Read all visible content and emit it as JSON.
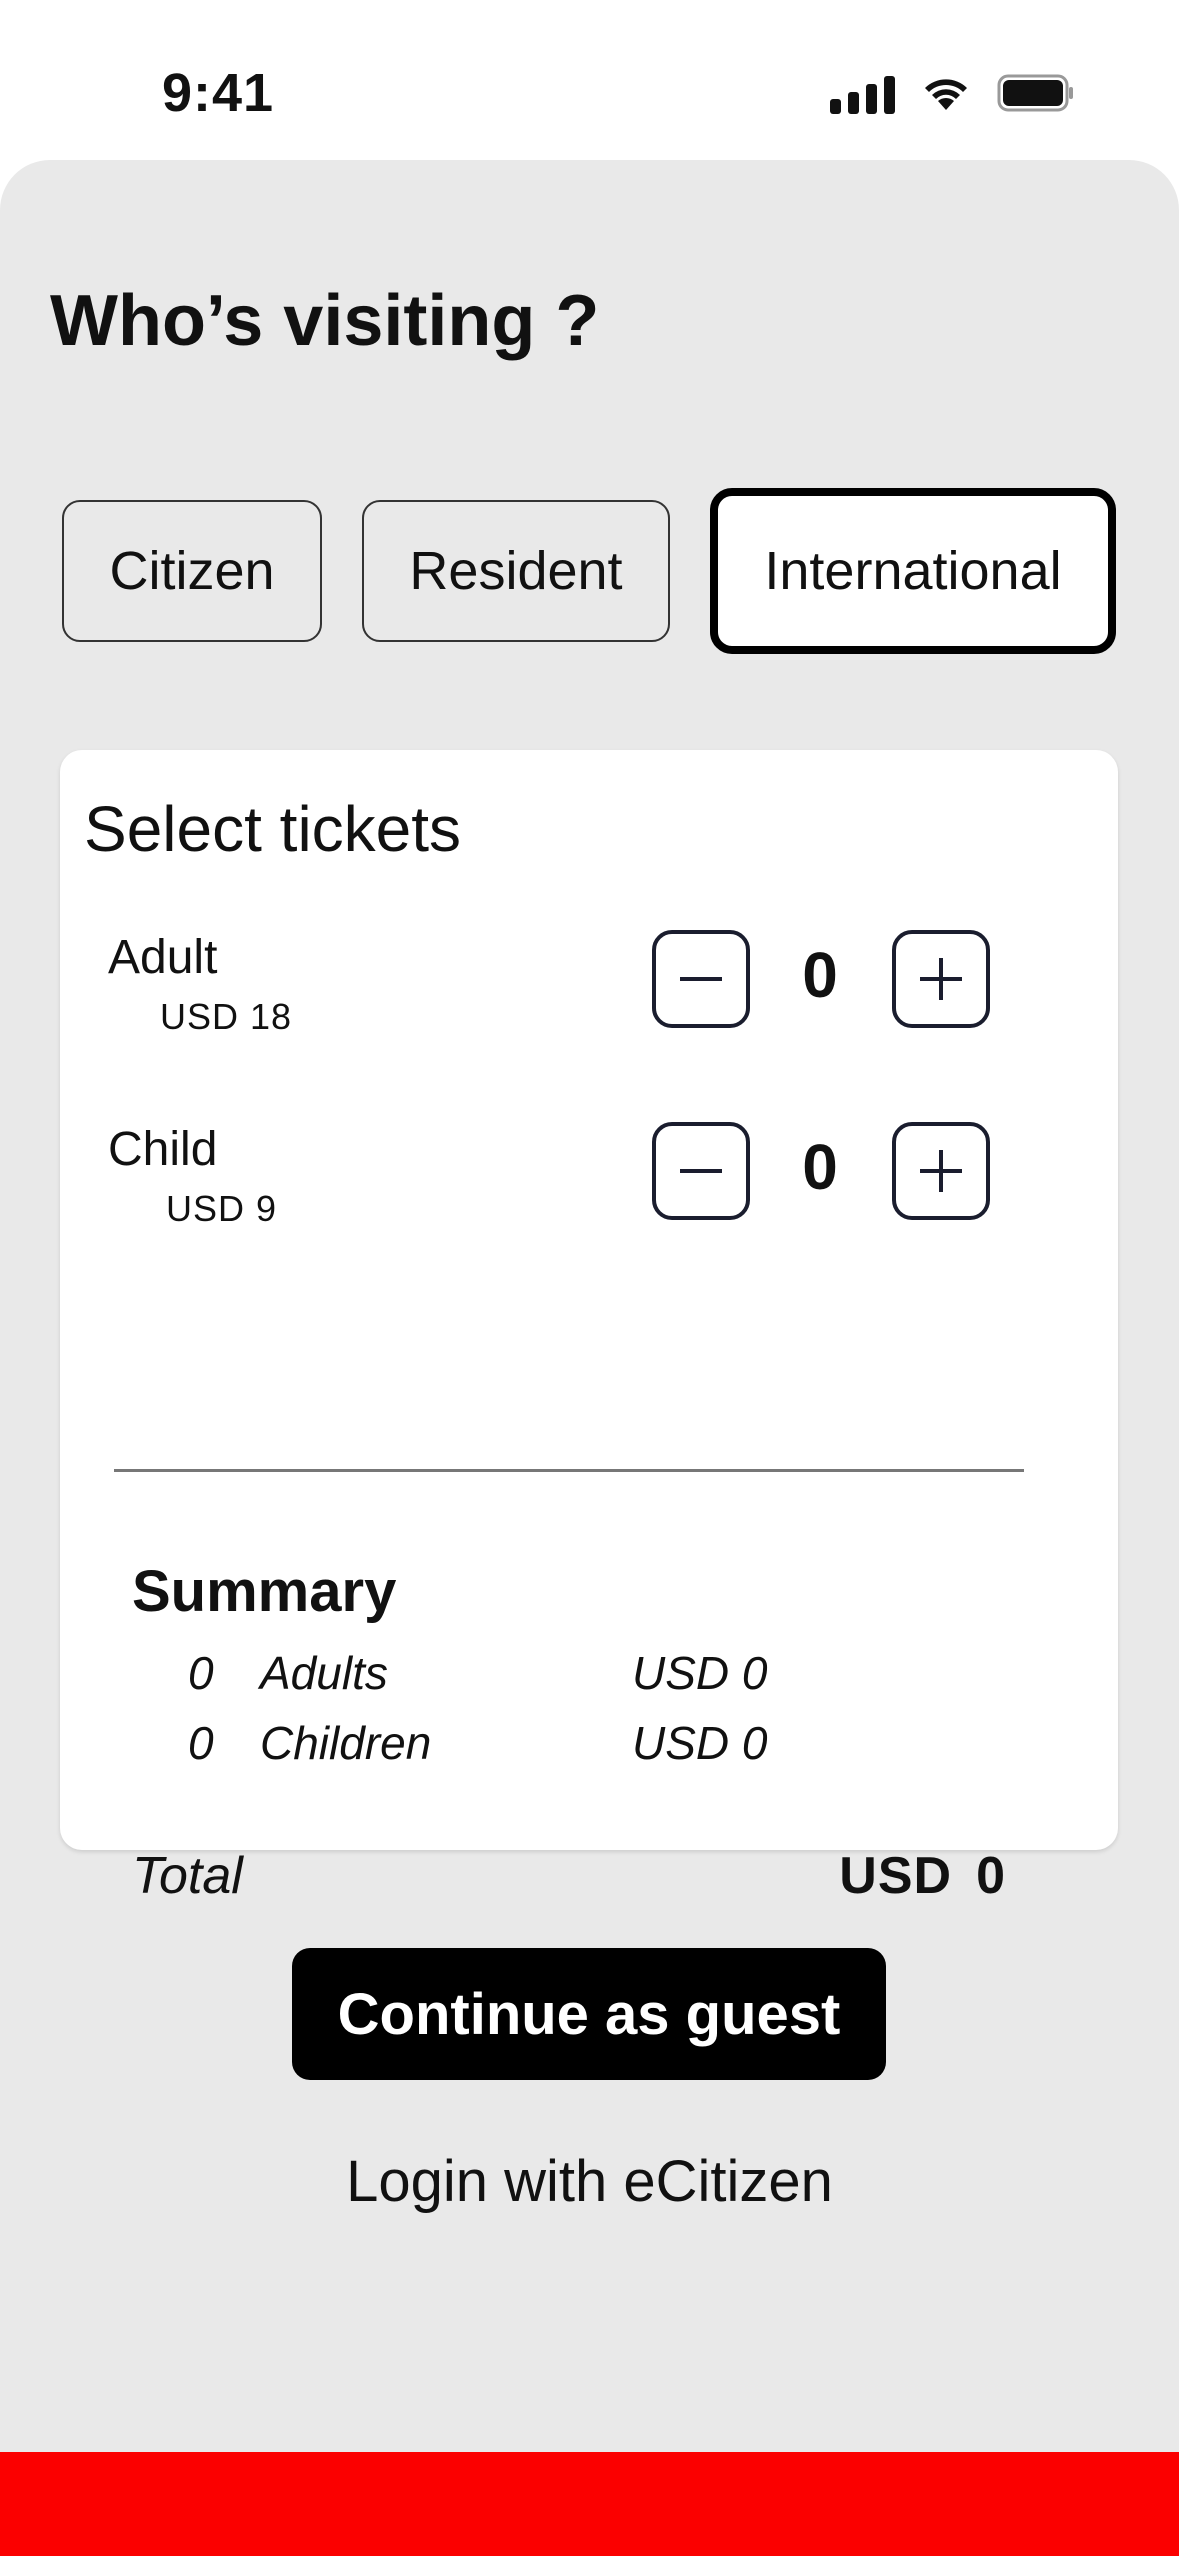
{
  "status_bar": {
    "time": "9:41",
    "icons": [
      "cellular-signal-icon",
      "wifi-icon",
      "battery-icon"
    ]
  },
  "page": {
    "title": "Who’s visiting ?"
  },
  "visitor_types": {
    "citizen": "Citizen",
    "resident": "Resident",
    "international": "International",
    "selected": "International"
  },
  "tickets": {
    "title": "Select tickets",
    "adult": {
      "label": "Adult",
      "price": "USD 18",
      "quantity": "0"
    },
    "child": {
      "label": "Child",
      "price": "USD 9",
      "quantity": "0"
    },
    "minus_icon": "minus-icon",
    "plus_icon": "plus-icon"
  },
  "summary": {
    "title": "Summary",
    "adults": {
      "count": "0",
      "label": "Adults",
      "amount": "USD 0"
    },
    "children": {
      "count": "0",
      "label": "Children",
      "amount": "USD 0"
    },
    "total_label": "Total",
    "total_currency": "USD",
    "total_amount": "0"
  },
  "actions": {
    "continue_label": "Continue as guest",
    "login_label": "Login with eCitizen"
  },
  "colors": {
    "sheet_background": "#e9e9e9",
    "primary_button": "#000000",
    "bottom_bar": "#fb0000"
  }
}
